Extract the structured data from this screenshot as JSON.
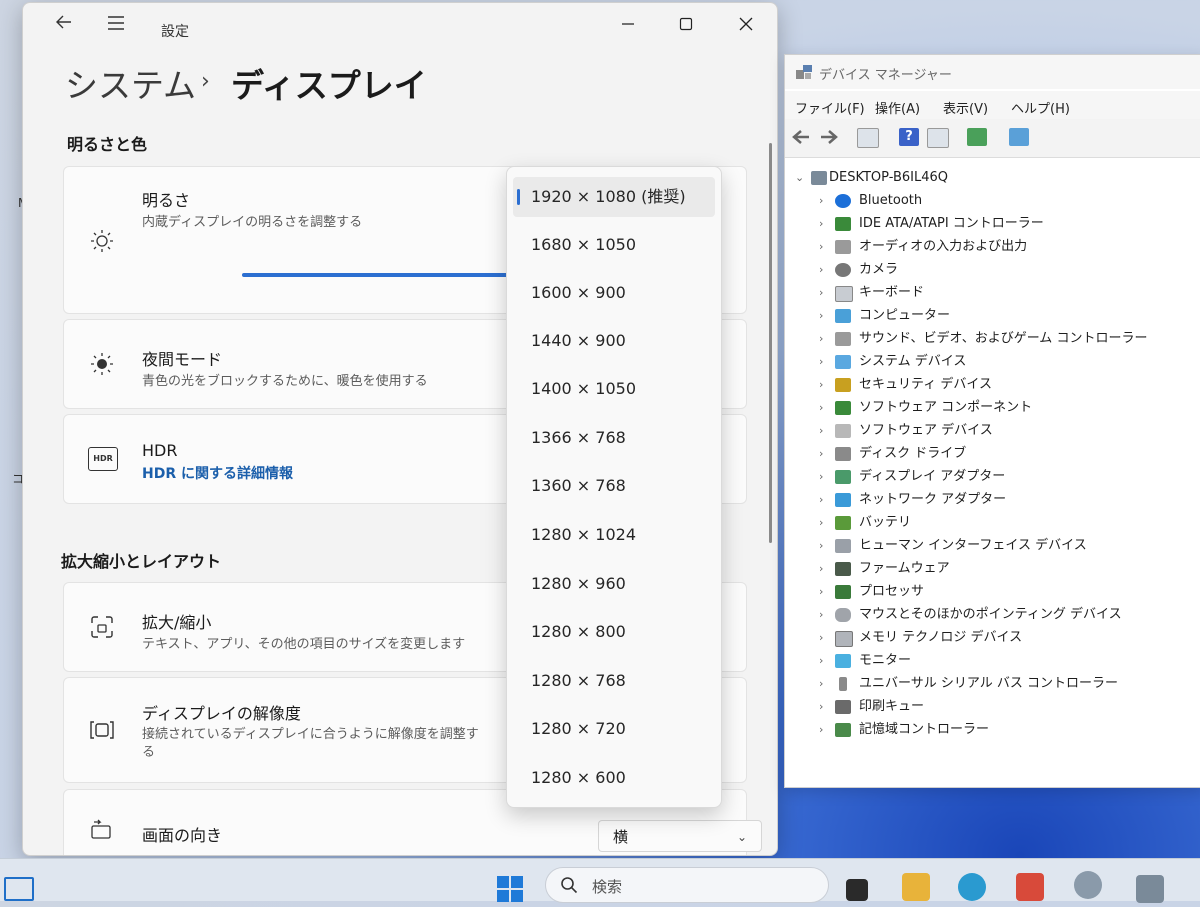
{
  "settings": {
    "app_title": "設定",
    "breadcrumb_parent": "システム",
    "breadcrumb_sep": "›",
    "breadcrumb_current": "ディスプレイ",
    "section_brightness": "明るさと色",
    "brightness": {
      "title": "明るさ",
      "desc": "内蔵ディスプレイの明るさを調整する"
    },
    "night_mode": {
      "title": "夜間モード",
      "desc": "青色の光をブロックするために、暖色を使用する"
    },
    "hdr": {
      "title": "HDR",
      "link": "HDR に関する詳細情報",
      "icon_text": "HDR"
    },
    "section_scale": "拡大縮小とレイアウト",
    "scale": {
      "title": "拡大/縮小",
      "desc": "テキスト、アプリ、その他の項目のサイズを変更します"
    },
    "resolution": {
      "title": "ディスプレイの解像度",
      "desc": "接続されているディスプレイに合うように解像度を調整する"
    },
    "orientation": {
      "title": "画面の向き",
      "value": "横"
    }
  },
  "resolution_dropdown": {
    "selected": "1920 × 1080 (推奨)",
    "options": [
      "1920 × 1080 (推奨)",
      "1680 × 1050",
      "1600 × 900",
      "1440 × 900",
      "1400 × 1050",
      "1366 × 768",
      "1360 × 768",
      "1280 × 1024",
      "1280 × 960",
      "1280 × 800",
      "1280 × 768",
      "1280 × 720",
      "1280 × 600"
    ]
  },
  "device_manager": {
    "title": "デバイス マネージャー",
    "menus": [
      "ファイル(F)",
      "操作(A)",
      "表示(V)",
      "ヘルプ(H)"
    ],
    "root": "DESKTOP-B6IL46Q",
    "categories": [
      "Bluetooth",
      "IDE ATA/ATAPI コントローラー",
      "オーディオの入力および出力",
      "カメラ",
      "キーボード",
      "コンピューター",
      "サウンド、ビデオ、およびゲーム コントローラー",
      "システム デバイス",
      "セキュリティ デバイス",
      "ソフトウェア コンポーネント",
      "ソフトウェア デバイス",
      "ディスク ドライブ",
      "ディスプレイ アダプター",
      "ネットワーク アダプター",
      "バッテリ",
      "ヒューマン インターフェイス デバイス",
      "ファームウェア",
      "プロセッサ",
      "マウスとそのほかのポインティング デバイス",
      "メモリ テクノロジ デバイス",
      "モニター",
      "ユニバーサル シリアル バス コントローラー",
      "印刷キュー",
      "記憶域コントローラー"
    ]
  },
  "taskbar": {
    "search_placeholder": "検索"
  },
  "desktop_fragments": [
    "M",
    "コ"
  ],
  "colors": {
    "accent": "#2c6fd1",
    "link": "#1b5fab"
  }
}
